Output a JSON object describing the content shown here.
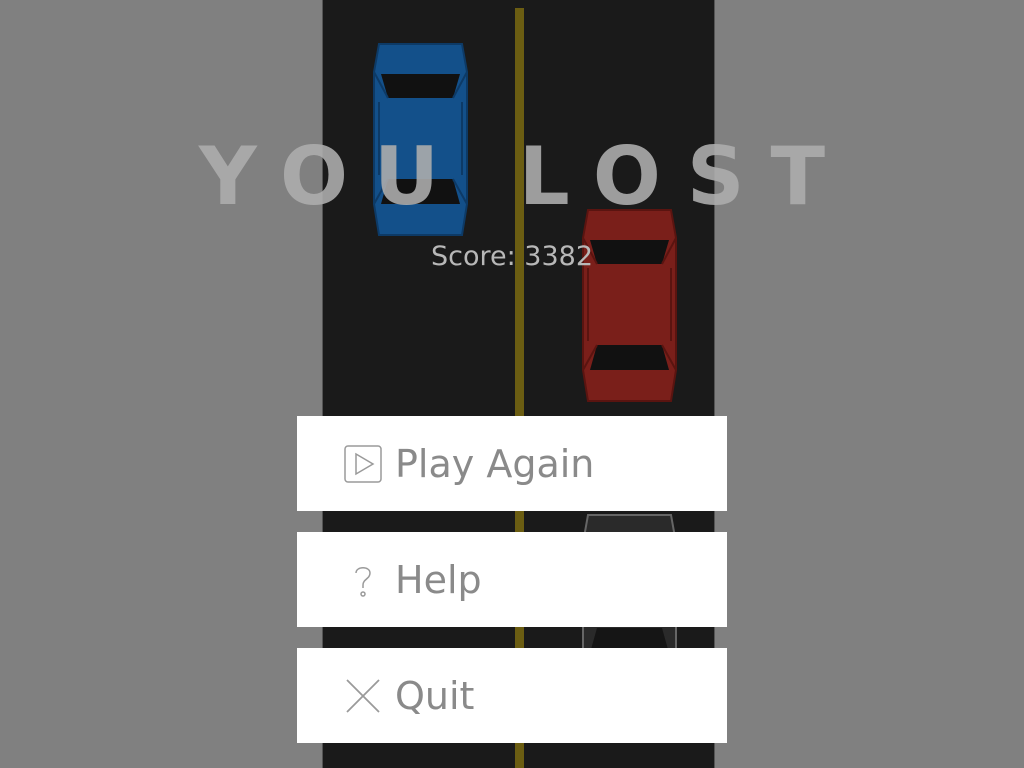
{
  "game": {
    "title": "YOU LOST",
    "score_text": "Score: 3382"
  },
  "menu": {
    "play_again_label": "Play Again",
    "help_label": "Help",
    "quit_label": "Quit"
  },
  "icons": {
    "play": "play-icon",
    "help": "question-icon",
    "quit": "close-icon"
  },
  "colors": {
    "background": "#808080",
    "road": "#1a1a1a",
    "center_line": "#6b5d12",
    "blue_car": "#13508a",
    "red_car": "#7a1f1a",
    "button_bg": "#ffffff",
    "button_text": "#8a8a8a"
  }
}
